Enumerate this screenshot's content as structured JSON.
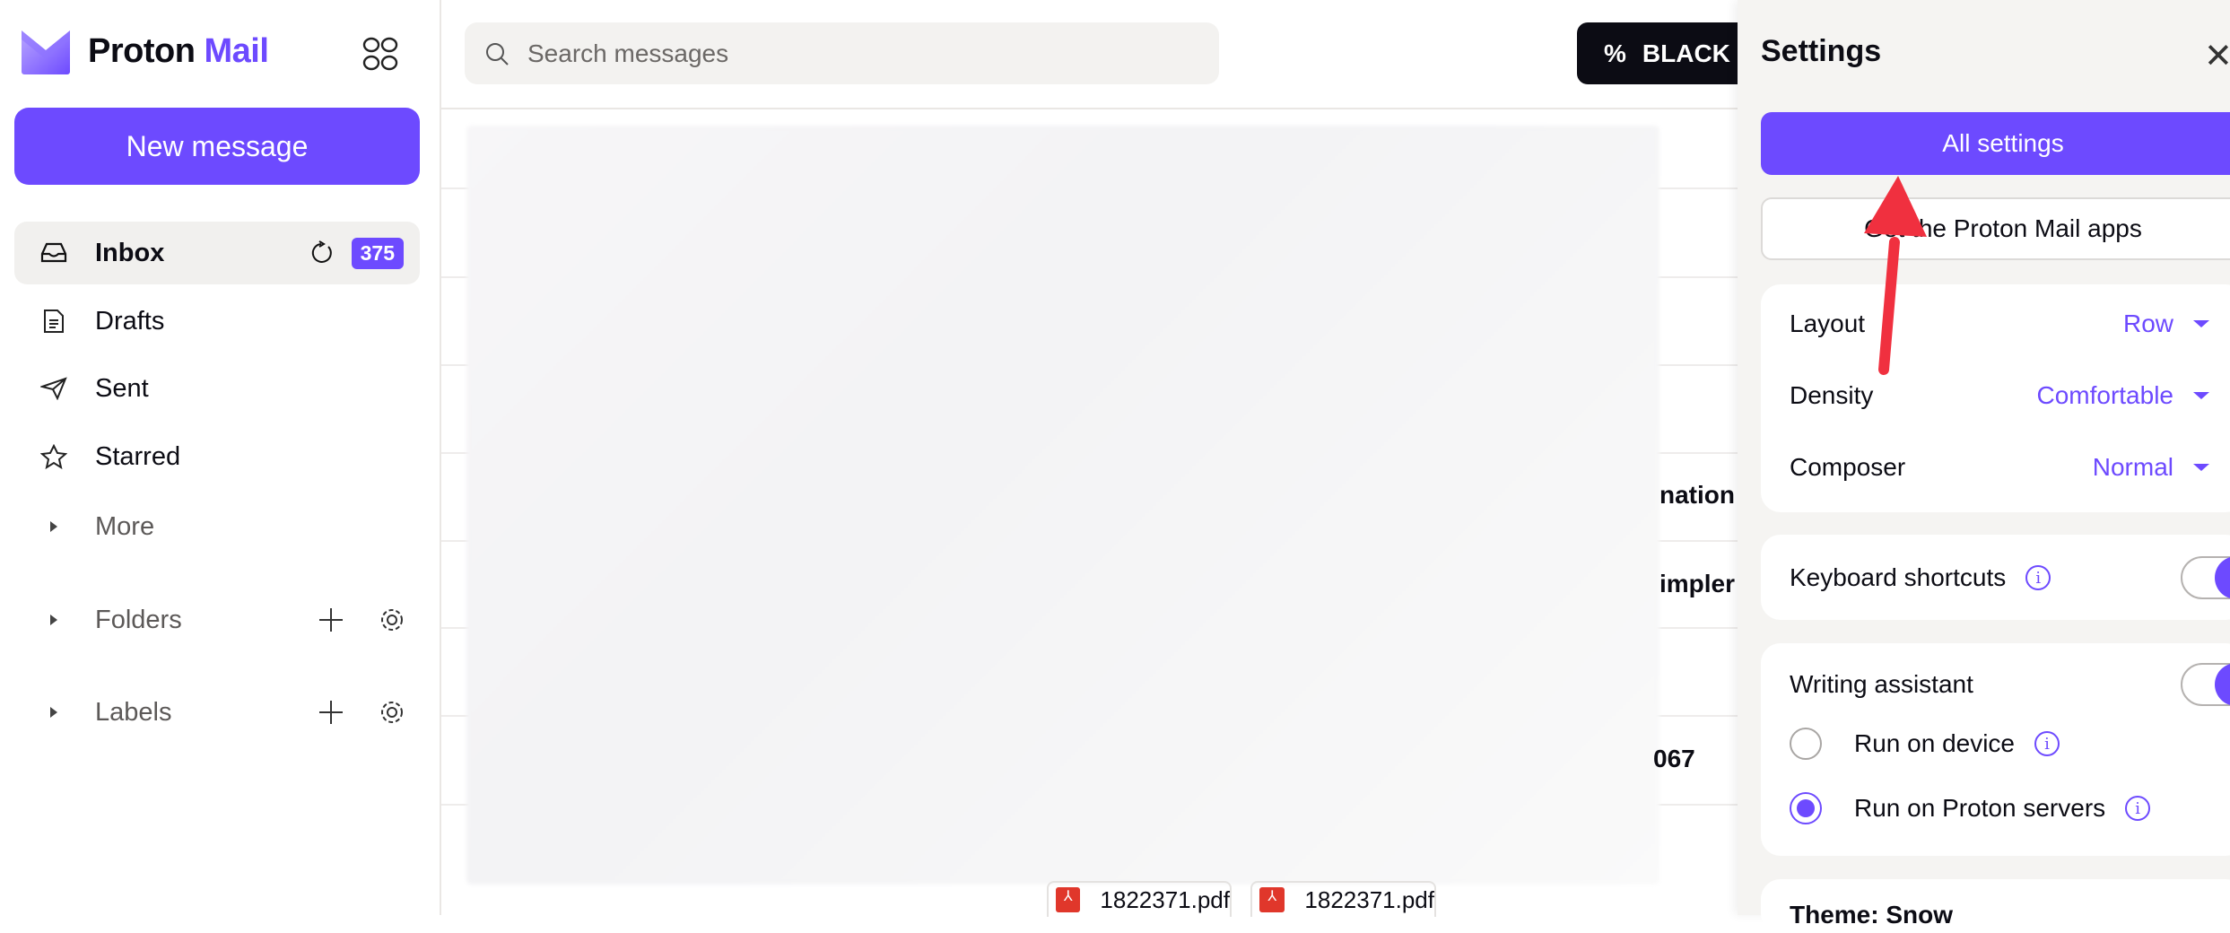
{
  "app": {
    "name_part1": "Proton",
    "name_part2": "Mail",
    "accent": "#6d4aff"
  },
  "sidebar": {
    "new_message": "New message",
    "items": [
      {
        "label": "Inbox",
        "icon": "inbox-icon",
        "count": "375"
      },
      {
        "label": "Drafts",
        "icon": "drafts-icon"
      },
      {
        "label": "Sent",
        "icon": "sent-icon"
      },
      {
        "label": "Starred",
        "icon": "star-icon"
      },
      {
        "label": "More",
        "icon": "caret-right-icon"
      }
    ],
    "folders": "Folders",
    "labels": "Labels"
  },
  "header": {
    "search_placeholder": "Search messages",
    "promo": "BLACK"
  },
  "list": {
    "fragments": [
      "nation",
      "impler",
      "067"
    ],
    "attachments": [
      "1822371.pdf",
      "1822371.pdf"
    ]
  },
  "settings": {
    "title": "Settings",
    "all_settings": "All settings",
    "get_apps": "Get the Proton Mail apps",
    "layout": {
      "label": "Layout",
      "value": "Row"
    },
    "density": {
      "label": "Density",
      "value": "Comfortable"
    },
    "composer": {
      "label": "Composer",
      "value": "Normal"
    },
    "keyboard_shortcuts": {
      "label": "Keyboard shortcuts",
      "enabled": true
    },
    "writing_assistant": {
      "label": "Writing assistant",
      "enabled": true,
      "options": [
        {
          "label": "Run on device",
          "selected": false
        },
        {
          "label": "Run on Proton servers",
          "selected": true
        }
      ]
    },
    "theme_partial": "Theme: Snow"
  },
  "annotation": {
    "arrow_color": "#f0303f"
  }
}
